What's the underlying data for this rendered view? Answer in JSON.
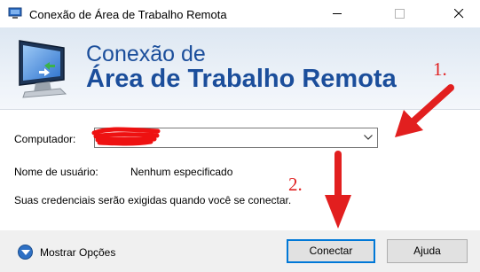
{
  "window": {
    "title": "Conexão de Área de Trabalho Remota"
  },
  "banner": {
    "line1": "Conexão de",
    "line2": "Área de Trabalho Remota"
  },
  "form": {
    "computer_label": "Computador:",
    "computer_value": "",
    "username_label": "Nome de usuário:",
    "username_value": "Nenhum especificado",
    "info_text": "Suas credenciais serão exigidas quando você se conectar."
  },
  "footer": {
    "options_label": "Mostrar Opções",
    "connect_label": "Conectar",
    "help_label": "Ajuda"
  },
  "annotations": {
    "step1": "1.",
    "step2": "2."
  },
  "icons": {
    "app": "remote-desktop-icon",
    "minimize": "minimize-icon",
    "maximize": "maximize-icon",
    "close": "close-icon",
    "dropdown": "chevron-down-icon",
    "options": "expand-options-icon"
  },
  "colors": {
    "banner_text": "#1b4e9b",
    "annotation": "#e02020",
    "accent": "#0078d7"
  }
}
